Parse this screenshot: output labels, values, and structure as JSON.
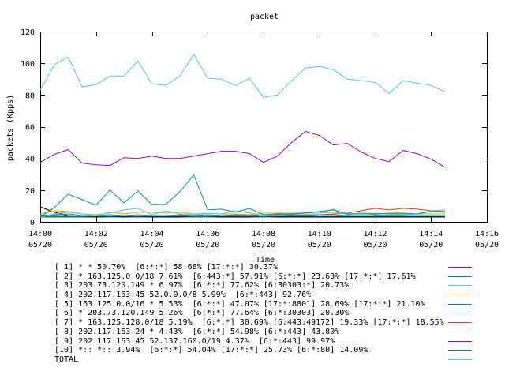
{
  "chart_data": {
    "type": "line",
    "title": "packet",
    "xlabel": "Time",
    "ylabel": "packets (Kpps)",
    "ylim": [
      0,
      120
    ],
    "y_ticks": [
      0,
      20,
      40,
      60,
      80,
      100,
      120
    ],
    "x_tick_labels": [
      {
        "time": "14:00",
        "date": "05/20"
      },
      {
        "time": "14:02",
        "date": "05/20"
      },
      {
        "time": "14:04",
        "date": "05/20"
      },
      {
        "time": "14:06",
        "date": "05/20"
      },
      {
        "time": "14:08",
        "date": "05/20"
      },
      {
        "time": "14:10",
        "date": "05/20"
      },
      {
        "time": "14:12",
        "date": "05/20"
      },
      {
        "time": "14:14",
        "date": "05/20"
      },
      {
        "time": "14:16",
        "date": "05/20"
      }
    ],
    "xlim": [
      "14:00",
      "14:16"
    ],
    "x": [
      "14:00",
      "14:00:30",
      "14:01",
      "14:01:30",
      "14:02",
      "14:02:30",
      "14:03",
      "14:03:30",
      "14:04",
      "14:04:30",
      "14:05",
      "14:05:30",
      "14:06",
      "14:06:30",
      "14:07",
      "14:07:30",
      "14:08",
      "14:08:30",
      "14:09",
      "14:09:30",
      "14:10",
      "14:10:30",
      "14:11",
      "14:11:30",
      "14:12",
      "14:12:30",
      "14:13",
      "14:13:30",
      "14:14",
      "14:14:30"
    ],
    "grid": false,
    "legend_placement": "bottom",
    "series": [
      {
        "name": "[ 1] * * 50.70%  [6:*:*] 58.68% [17:*:*] 30.37%",
        "color": "#a000c0",
        "values": [
          37.5,
          42.5,
          45.5,
          37.0,
          36.0,
          35.5,
          40.5,
          40.0,
          41.5,
          40.0,
          40.0,
          41.5,
          43.0,
          44.5,
          44.5,
          43.0,
          37.5,
          41.5,
          50.0,
          57.0,
          54.5,
          48.5,
          49.5,
          44.0,
          40.0,
          38.0,
          45.0,
          43.0,
          39.5,
          34.5
        ]
      },
      {
        "name": "[ 2] * 163.125.0.0/18 7.61%  [6:443:*] 57.91% [6:*:*] 23.63% [17:*:*] 17.61%",
        "color": "#009a90",
        "values": [
          3.0,
          9.0,
          17.5,
          14.0,
          10.5,
          20.0,
          12.0,
          19.5,
          11.0,
          11.0,
          19.0,
          29.5,
          7.5,
          8.0,
          6.0,
          8.5,
          4.5,
          5.0,
          5.0,
          5.5,
          6.5,
          7.5,
          5.0,
          5.0,
          5.0,
          5.5,
          5.5,
          5.0,
          6.5,
          6.0
        ]
      },
      {
        "name": "[ 3] 203.73.120.149 * 6.97%  [6:*:*] 77.62% [6:30303:*] 20.73%",
        "color": "#50c8e6",
        "values": [
          3.0,
          5.0,
          6.0,
          5.0,
          4.5,
          5.5,
          7.5,
          8.5,
          4.5,
          7.0,
          5.0,
          4.5,
          5.5,
          5.0,
          7.0,
          5.5,
          4.0,
          4.0,
          5.0,
          6.0,
          5.5,
          8.0,
          4.5,
          5.5,
          4.5,
          4.5,
          4.5,
          5.0,
          7.0,
          7.5
        ]
      },
      {
        "name": "[ 4] 202.117.163.45 52.0.0.0/8 5.99%  [6:*:443] 92.76%",
        "color": "#e8a800",
        "values": [
          5.0,
          7.0,
          6.5,
          5.0,
          4.0,
          6.0,
          5.0,
          6.0,
          6.0,
          5.5,
          6.0,
          5.0,
          5.5,
          5.0,
          5.0,
          4.5,
          5.5,
          5.5,
          5.5,
          5.5,
          5.5,
          6.0,
          5.0,
          5.5,
          5.5,
          5.0,
          5.0,
          5.0,
          5.0,
          5.0
        ]
      },
      {
        "name": "[ 5] 163.125.0.0/16 * 5.53%  [6:*:*] 47.07% [17:*:8801] 28.69% [17:*:*] 21.10%",
        "color": "#009a90",
        "values": [
          4.0,
          4.5,
          5.0,
          4.0,
          4.0,
          4.5,
          4.0,
          4.5,
          4.0,
          4.0,
          4.5,
          4.0,
          4.5,
          4.0,
          4.0,
          4.5,
          4.0,
          4.0,
          4.0,
          4.0,
          4.5,
          4.5,
          4.0,
          4.0,
          4.0,
          4.0,
          4.0,
          4.0,
          4.0,
          4.0
        ]
      },
      {
        "name": "[ 6] * 203.73.120.149 5.26%  [6:*:*] 77.64% [6:*:30303] 20.30%",
        "color": "#1060b0",
        "values": [
          3.5,
          3.5,
          3.5,
          3.5,
          3.5,
          3.5,
          3.5,
          3.5,
          3.5,
          3.5,
          3.5,
          3.5,
          3.5,
          3.5,
          3.5,
          3.5,
          3.5,
          3.5,
          3.5,
          3.5,
          3.5,
          3.5,
          3.5,
          3.5,
          3.5,
          3.5,
          3.5,
          3.5,
          3.5,
          3.5
        ]
      },
      {
        "name": "[ 7] * 163.125.128.0/18 5.19%  [6:*:*] 30.69% [6:443:49172] 19.33% [17:*:*] 18.55%",
        "color": "#e04020",
        "values": [
          4.5,
          4.0,
          4.0,
          3.5,
          3.5,
          3.5,
          4.0,
          3.5,
          4.0,
          3.5,
          4.0,
          4.0,
          4.5,
          4.0,
          4.5,
          4.0,
          4.0,
          4.5,
          4.5,
          4.5,
          4.5,
          5.0,
          5.5,
          7.0,
          8.5,
          7.5,
          8.5,
          8.0,
          7.0,
          6.5
        ]
      },
      {
        "name": "[ 8] 202.117.163.24 * 4.43%  [6:*:*] 54.98% [6:*:443] 43.80%",
        "color": "#000000",
        "values": [
          9.5,
          6.0,
          4.0,
          3.5,
          3.0,
          3.5,
          3.0,
          3.5,
          3.0,
          3.0,
          3.0,
          3.5,
          3.5,
          3.0,
          3.0,
          3.0,
          3.5,
          3.0,
          3.0,
          3.0,
          3.0,
          3.0,
          3.0,
          3.0,
          3.0,
          3.0,
          3.0,
          3.0,
          3.0,
          3.0
        ]
      },
      {
        "name": "[ 9] 202.117.163.45 52.137.160.0/19 4.37%  [6:*:443] 99.97%",
        "color": "#a000c0",
        "values": [
          3.5,
          3.5,
          3.5,
          3.5,
          3.0,
          3.5,
          3.5,
          3.0,
          3.5,
          3.5,
          3.5,
          3.5,
          3.5,
          3.5,
          3.5,
          3.5,
          3.5,
          3.5,
          3.5,
          3.5,
          3.5,
          3.5,
          3.5,
          3.5,
          3.5,
          3.5,
          3.5,
          3.5,
          3.5,
          3.5
        ]
      },
      {
        "name": "[10] *:: *:: 3.94%  [6:*:*] 54.04% [17:*:*] 25.73% [6:*:80] 14.09%",
        "color": "#008060",
        "values": [
          3.0,
          3.0,
          3.0,
          3.0,
          3.0,
          3.0,
          3.0,
          3.0,
          3.0,
          3.0,
          3.0,
          3.0,
          3.0,
          3.0,
          3.0,
          3.0,
          3.0,
          3.0,
          3.0,
          3.0,
          3.0,
          3.0,
          3.0,
          3.0,
          3.0,
          3.0,
          3.0,
          3.0,
          3.0,
          3.0
        ]
      },
      {
        "name": "TOTAL",
        "color": "#50c8e6",
        "values": [
          83,
          99,
          104,
          85,
          86.5,
          92,
          92,
          101.5,
          87,
          86,
          92,
          105.5,
          90.5,
          90,
          86,
          90.5,
          78.5,
          80,
          89,
          97,
          98,
          96,
          90,
          89,
          88,
          81,
          89,
          87.5,
          86,
          82
        ]
      }
    ]
  }
}
